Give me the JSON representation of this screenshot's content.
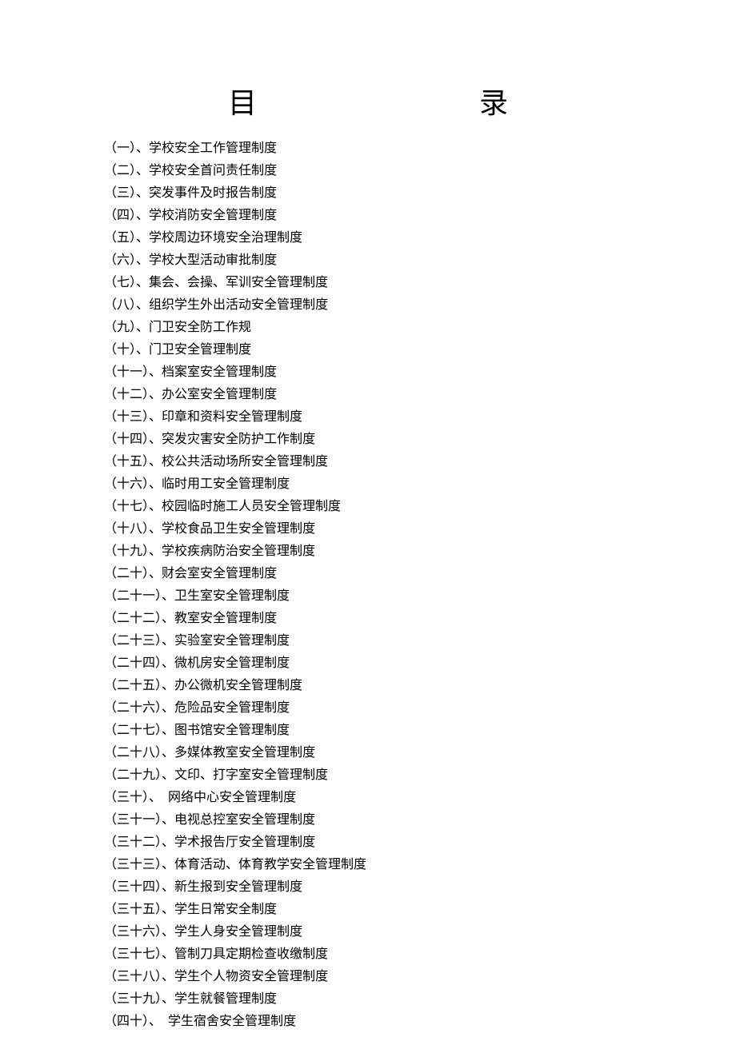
{
  "title": {
    "char1": "目",
    "char2": "录"
  },
  "toc": [
    "（一）、学校安全工作管理制度",
    "（二）、学校安全首问责任制度",
    "（三）、突发事件及时报告制度",
    "（四）、学校消防安全管理制度",
    "（五）、学校周边环境安全治理制度",
    "（六）、学校大型活动审批制度",
    "（七）、集会、会操、军训安全管理制度",
    "（八）、组织学生外出活动安全管理制度",
    "（九）、门卫安全防工作规",
    "（十）、门卫安全管理制度",
    "（十一）、档案室安全管理制度",
    "（十二）、办公室安全管理制度",
    "（十三）、印章和资料安全管理制度",
    "（十四）、突发灾害安全防护工作制度",
    "（十五）、校公共活动场所安全管理制度",
    "（十六）、临时用工安全管理制度",
    "（十七）、校园临时施工人员安全管理制度",
    "（十八）、学校食品卫生安全管理制度",
    "（十九）、学校疾病防治安全管理制度",
    "（二十）、财会室安全管理制度",
    "（二十一）、卫生室安全管理制度",
    "（二十二）、教室安全管理制度",
    "（二十三）、实验室安全管理制度",
    "（二十四）、微机房安全管理制度",
    "（二十五）、办公微机安全管理制度",
    "（二十六）、危险品安全管理制度",
    "（二十七）、图书馆安全管理制度",
    "（二十八）、多媒体教室安全管理制度",
    "（二十九）、文印、打字室安全管理制度",
    "（三十）、　网络中心安全管理制度",
    "（三十一）、电视总控室安全管理制度",
    "（三十二）、学术报告厅安全管理制度",
    "（三十三）、体育活动、体育教学安全管理制度",
    "（三十四）、新生报到安全管理制度",
    "（三十五）、学生日常安全制度",
    "（三十六）、学生人身安全管理制度",
    "（三十七）、管制刀具定期检查收缴制度",
    "（三十八）、学生个人物资安全管理制度",
    "（三十九）、学生就餐管理制度",
    "（四十）、　学生宿舍安全管理制度"
  ]
}
